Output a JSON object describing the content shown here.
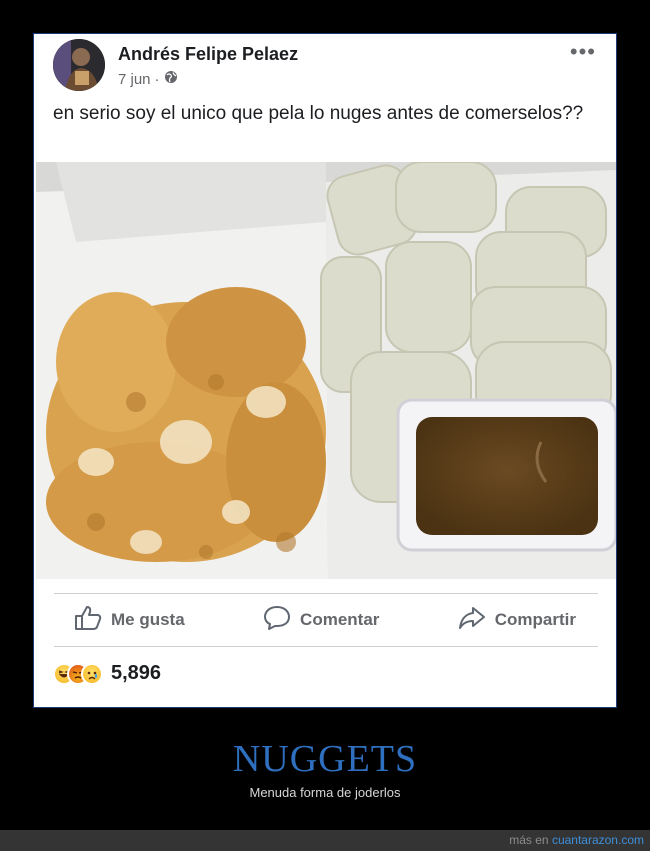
{
  "post": {
    "author": "Andrés Felipe Pelaez",
    "date": "7 jun",
    "separator": "·",
    "privacy_icon": "globe-icon",
    "more_label": "•••",
    "text": "en serio soy el unico que pela lo nuges antes de comerselos??"
  },
  "actions": {
    "like": "Me gusta",
    "comment": "Comentar",
    "share": "Compartir"
  },
  "reactions": {
    "icons": [
      "haha-icon",
      "angry-icon",
      "sad-icon"
    ],
    "count": "5,896"
  },
  "caption": {
    "title": "NUGGETS",
    "subtitle": "Menuda forma de joderlos"
  },
  "footer": {
    "prefix": "más en",
    "site": "cuantarazon.com"
  },
  "colors": {
    "caption_title": "#2f6fbf",
    "footer_link": "#3f8fd9",
    "frame_border": "#1d3a7a"
  }
}
